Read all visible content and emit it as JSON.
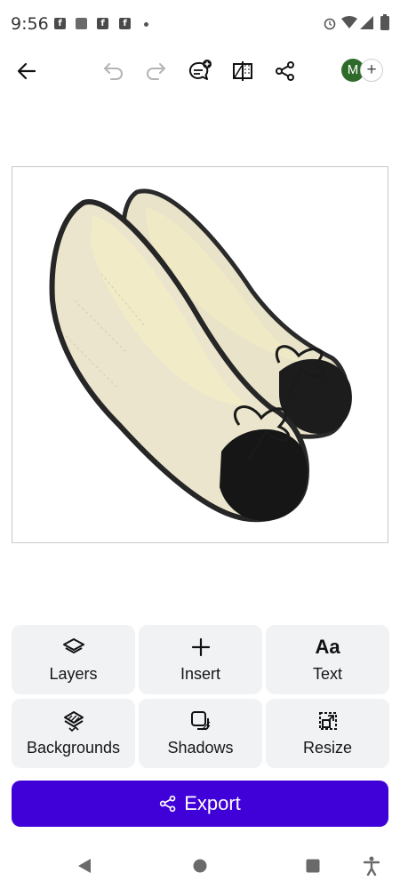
{
  "status_bar": {
    "time": "9:56",
    "notification_icons": [
      "facebook-icon",
      "news-icon",
      "facebook-icon",
      "facebook-icon"
    ],
    "system_icons": [
      "alarm-icon",
      "wifi-icon",
      "signal-icon",
      "battery-icon"
    ]
  },
  "toolbar": {
    "avatar_initial": "M",
    "add_collaborator": "+"
  },
  "canvas": {
    "subject": "shoe-illustration"
  },
  "actions": [
    {
      "label": "Layers",
      "icon": "layers-icon"
    },
    {
      "label": "Insert",
      "icon": "plus-icon"
    },
    {
      "label": "Text",
      "icon": "text-icon",
      "glyph": "Aa"
    },
    {
      "label": "Backgrounds",
      "icon": "backgrounds-icon"
    },
    {
      "label": "Shadows",
      "icon": "shadows-icon"
    },
    {
      "label": "Resize",
      "icon": "resize-icon"
    }
  ],
  "export": {
    "label": "Export"
  },
  "colors": {
    "accent": "#4000d8",
    "avatar": "#2e6b2a",
    "tile_bg": "#f1f2f4"
  }
}
